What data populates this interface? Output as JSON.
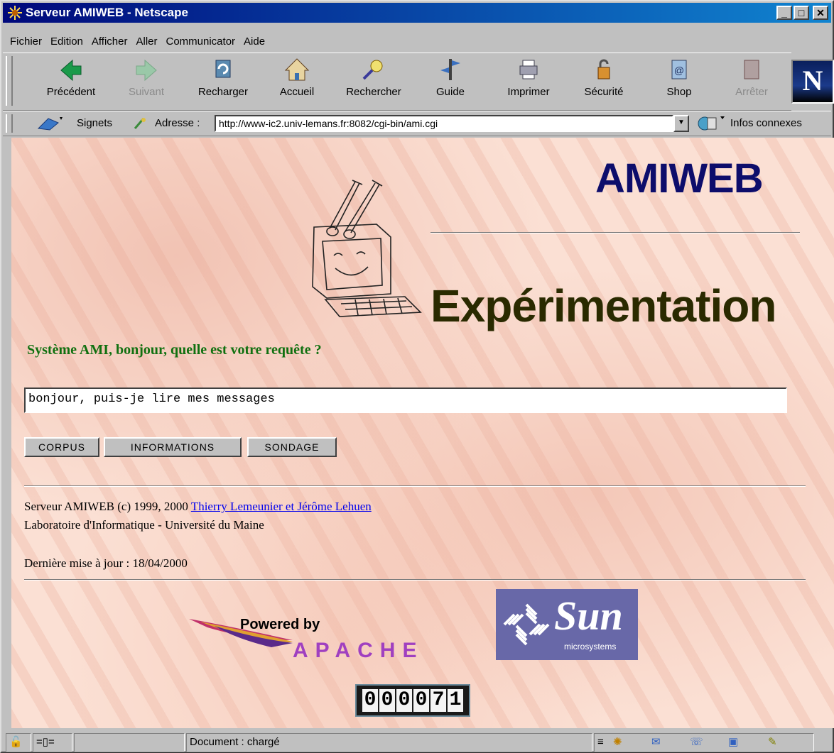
{
  "window": {
    "title": "Serveur AMIWEB - Netscape",
    "btn_min": "_",
    "btn_max": "□",
    "btn_close": "✕"
  },
  "menu": [
    "Fichier",
    "Edition",
    "Afficher",
    "Aller",
    "Communicator",
    "Aide"
  ],
  "toolbar": [
    {
      "label": "Précédent",
      "icon": "back-arrow-icon",
      "enabled": true
    },
    {
      "label": "Suivant",
      "icon": "forward-arrow-icon",
      "enabled": false
    },
    {
      "label": "Recharger",
      "icon": "reload-icon",
      "enabled": true
    },
    {
      "label": "Accueil",
      "icon": "home-icon",
      "enabled": true
    },
    {
      "label": "Rechercher",
      "icon": "search-icon",
      "enabled": true
    },
    {
      "label": "Guide",
      "icon": "guide-icon",
      "enabled": true
    },
    {
      "label": "Imprimer",
      "icon": "printer-icon",
      "enabled": true
    },
    {
      "label": "Sécurité",
      "icon": "lock-icon",
      "enabled": true
    },
    {
      "label": "Shop",
      "icon": "shop-icon",
      "enabled": true
    },
    {
      "label": "Arrêter",
      "icon": "stop-icon",
      "enabled": false
    }
  ],
  "netscape_logo": "N",
  "location": {
    "bookmarks_label": "Signets",
    "address_label": "Adresse :",
    "url": "http://www-ic2.univ-lemans.fr:8082/cgi-bin/ami.cgi",
    "related_label": "Infos connexes"
  },
  "page": {
    "heading": "AMIWEB",
    "subheading": "Expérimentation",
    "prompt": "Système AMI, bonjour, quelle est votre requête ?",
    "query_value": "bonjour, puis-je lire mes messages",
    "buttons": [
      "CORPUS",
      "INFORMATIONS",
      "SONDAGE"
    ],
    "credit_prefix": "Serveur AMIWEB (c) 1999, 2000",
    "credit_link": "Thierry Lemeunier et Jérôme Lehuen",
    "lab": "Laboratoire d'Informatique - Université du Maine",
    "updated": "Dernière mise à jour : 18/04/2000",
    "apache_powered": "Powered by",
    "apache_name": "APACHE",
    "sun_name": "Sun",
    "sun_sub": "microsystems",
    "counter": [
      "0",
      "0",
      "0",
      "0",
      "7",
      "1"
    ]
  },
  "status": {
    "text": "Document : chargé"
  }
}
